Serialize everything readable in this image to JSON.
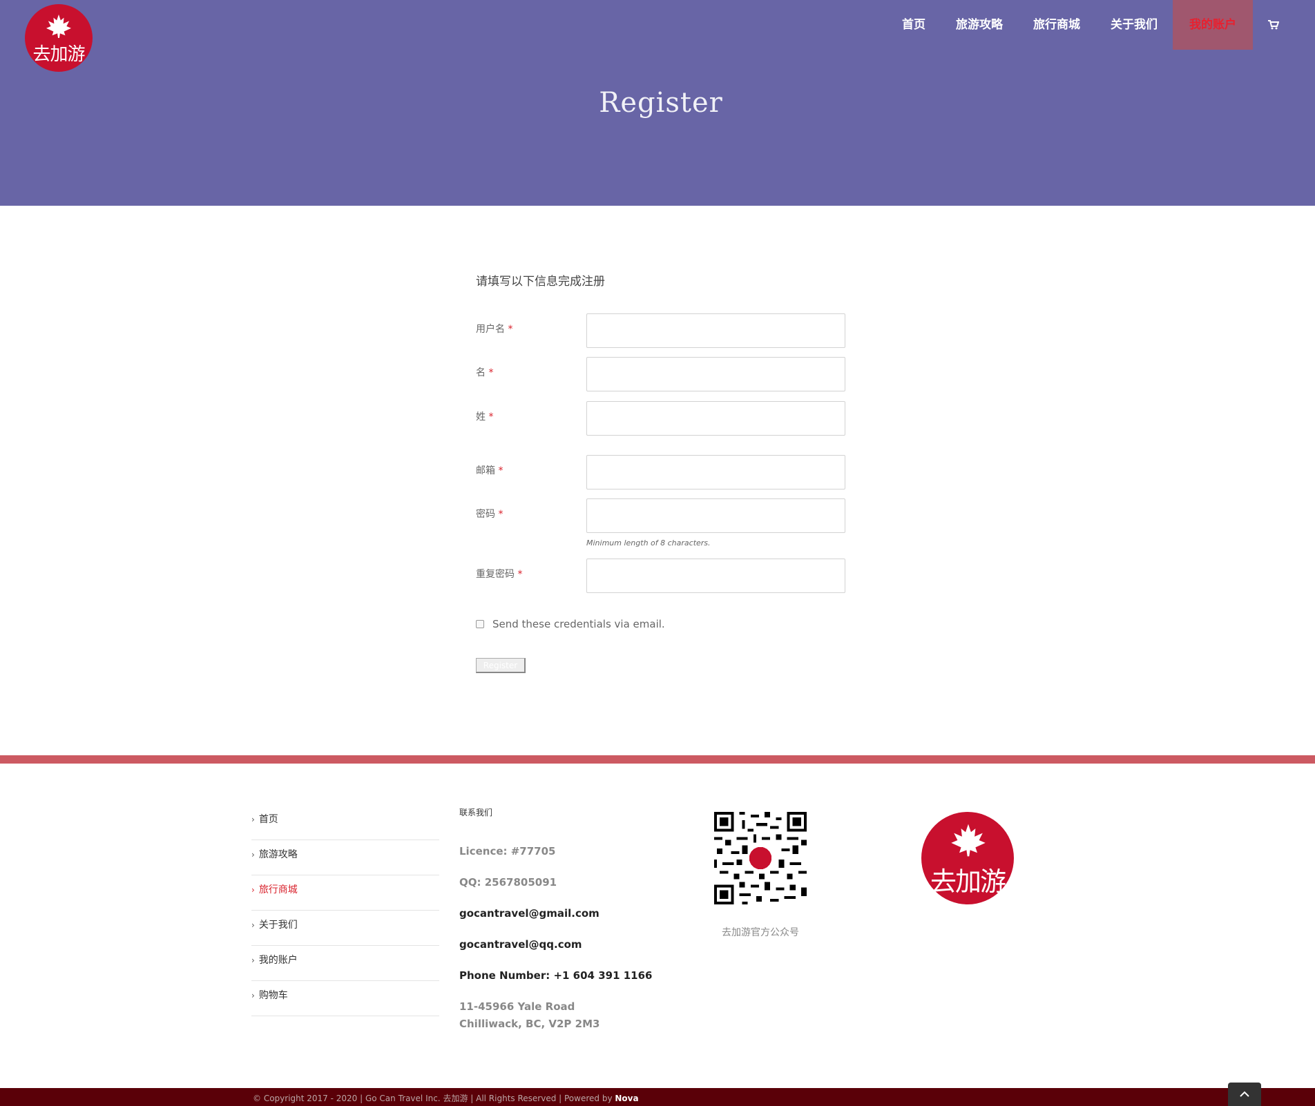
{
  "header": {
    "logo_text": "去加游",
    "nav": [
      "首页",
      "旅游攻略",
      "旅行商城",
      "关于我们",
      "我的账户"
    ],
    "active_nav": "我的账户",
    "page_title": "Register"
  },
  "form": {
    "intro": "请填写以下信息完成注册",
    "fields": [
      {
        "label": "用户名",
        "required": "*"
      },
      {
        "label": "名",
        "required": "*"
      },
      {
        "label": "姓",
        "required": "*"
      },
      {
        "label": "邮箱",
        "required": "*"
      },
      {
        "label": "密码",
        "required": "*",
        "hint": "Minimum length of 8 characters."
      },
      {
        "label": "重复密码",
        "required": "*"
      }
    ],
    "checkbox_label": "Send these credentials via email.",
    "submit_label": "Register"
  },
  "footer": {
    "menu": [
      "首页",
      "旅游攻略",
      "旅行商城",
      "关于我们",
      "我的账户",
      "购物车"
    ],
    "menu_current": "旅行商城",
    "contact_title": "联系我们",
    "licence": "Licence: #77705",
    "qq": "QQ: 2567805091",
    "email1": "gocantravel@gmail.com",
    "email2": "gocantravel@qq.com",
    "phone": "Phone Number: +1 604 391 1166",
    "address1": "11-45966 Yale Road",
    "address2": "Chilliwack, BC, V2P 2M3",
    "qr_caption": "去加游官方公众号",
    "logo_text": "去加游",
    "copyright": "© Copyright 2017 - 2020   |   Go Can Travel Inc. 去加游   |   All Rights Reserved   |   Powered by",
    "powered_by": "Nova"
  },
  "colors": {
    "header_bg": "#6865a6",
    "brand_red": "#c8102e",
    "footer_bar": "#cc5a62",
    "copyright_bg": "#5a0008"
  },
  "icons": {
    "cart": "shopping-cart-icon",
    "to_top": "chevron-up-icon",
    "menu_bullet": "chevron-right-icon"
  }
}
